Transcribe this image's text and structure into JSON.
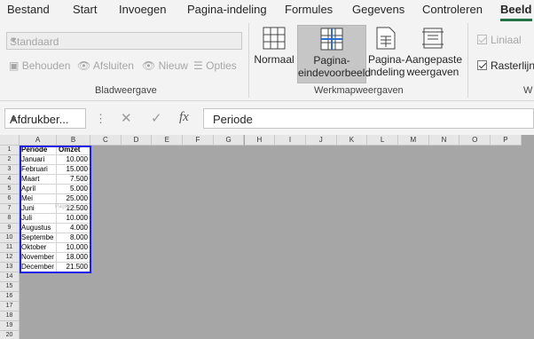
{
  "ribbon_tabs": [
    "Bestand",
    "Start",
    "Invoegen",
    "Pagina-indeling",
    "Formules",
    "Gegevens",
    "Controleren",
    "Beeld"
  ],
  "active_tab": "Beeld",
  "colors": {
    "accent": "#217346",
    "print_area": "#1e1ee6",
    "grid_background": "#a6a6a6"
  },
  "sheet_view": {
    "selector_value": "Standaard",
    "keep_label": "Behouden",
    "exit_label": "Afsluiten",
    "new_label": "Nieuw",
    "options_label": "Opties",
    "group_label": "Bladweergave"
  },
  "workbook_views": {
    "normal_label": "Normaal",
    "page_break_label_1": "Pagina-",
    "page_break_label_2": "eindevoorbeeld",
    "page_layout_label_1": "Pagina-",
    "page_layout_label_2": "indeling",
    "custom_label_1": "Aangepaste",
    "custom_label_2": "weergaven",
    "group_label": "Werkmapweergaven"
  },
  "show": {
    "ruler_label": "Liniaal",
    "gridlines_label": "Rasterlijnen",
    "group_label_partial": "W"
  },
  "formula_bar": {
    "name_box": "Afdrukber...",
    "dots": "⋮",
    "cancel_icon": "✕",
    "enter_icon": "✓",
    "fx_label": "fx",
    "formula": "Periode"
  },
  "grid": {
    "columns": [
      "A",
      "B",
      "C",
      "D",
      "E",
      "F",
      "G",
      "H",
      "I",
      "J",
      "K",
      "L",
      "M",
      "N",
      "O",
      "P"
    ],
    "rows": [
      "1",
      "2",
      "3",
      "4",
      "5",
      "6",
      "7",
      "8",
      "9",
      "10",
      "11",
      "12",
      "13",
      "14",
      "15",
      "16",
      "17",
      "18",
      "19",
      "20"
    ],
    "header_a": "Periode",
    "header_b": "Omzet",
    "data": [
      [
        "Januari",
        "10.000"
      ],
      [
        "Februari",
        "15.000"
      ],
      [
        "Maart",
        "7.500"
      ],
      [
        "April",
        "5.000"
      ],
      [
        "Mei",
        "25.000"
      ],
      [
        "Juni",
        "12.500"
      ],
      [
        "Juli",
        "10.000"
      ],
      [
        "Augustus",
        "4.000"
      ],
      [
        "Septembe",
        "8.000"
      ],
      [
        "Oktober",
        "10.000"
      ],
      [
        "November",
        "18.000"
      ],
      [
        "December",
        "21.500"
      ]
    ],
    "page_watermark": "Pagina 1"
  }
}
